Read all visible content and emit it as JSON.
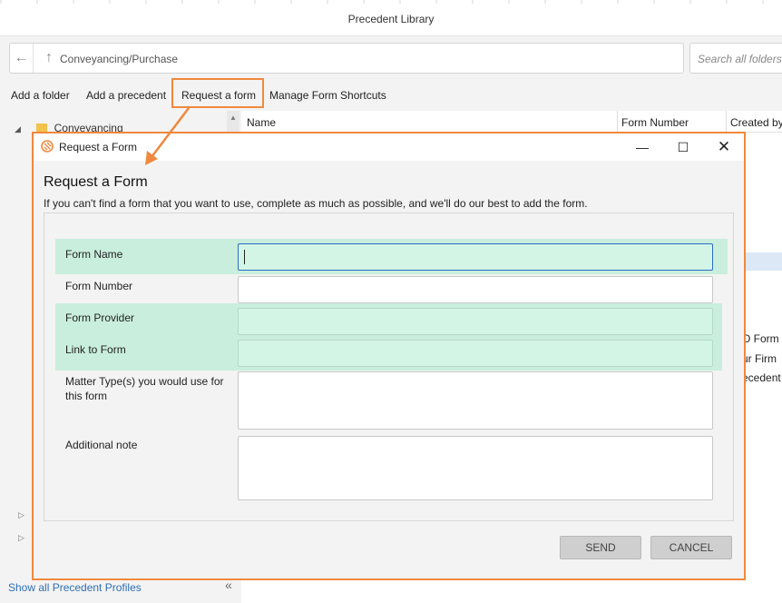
{
  "background_window": {
    "title": "Precedent Library",
    "address": {
      "path": "Conveyancing/Purchase",
      "search_placeholder": "Search all folders"
    },
    "toolbar": {
      "add_folder": "Add a folder",
      "add_precedent": "Add a precedent",
      "request_form": "Request a form",
      "manage_shortcuts": "Manage Form Shortcuts"
    },
    "tree": {
      "folder": "Conveyancing"
    },
    "grid": {
      "columns": [
        "Name",
        "Form Number",
        "Created by"
      ],
      "peek_rows": [
        "O Form",
        "ur Firm",
        "ecedent"
      ]
    },
    "footer": {
      "show_profiles": "Show all Precedent Profiles",
      "collapse": "«"
    }
  },
  "dialog": {
    "title": "Request a Form",
    "heading": "Request a Form",
    "subtitle": "If you can't find a form that you want to use, complete as much as possible, and we'll do our best to add the form.",
    "window_buttons": {
      "minimize": "—",
      "maximize": "☐",
      "close": "✕"
    },
    "fields": {
      "form_name": {
        "label": "Form Name",
        "value": ""
      },
      "form_number": {
        "label": "Form Number",
        "value": ""
      },
      "form_provider": {
        "label": "Form Provider",
        "value": ""
      },
      "link_to_form": {
        "label": "Link to Form",
        "value": ""
      },
      "matter_types": {
        "label": "Matter Type(s) you would use for this form",
        "value": ""
      },
      "additional_note": {
        "label": "Additional note",
        "value": ""
      }
    },
    "buttons": {
      "send": "SEND",
      "cancel": "CANCEL"
    }
  },
  "colors": {
    "annotation": "#f0883e",
    "highlight_row": "#c9eedd",
    "input_green": "#d3f5e6",
    "focus_border": "#2b6cc4",
    "link": "#2f6fb5"
  }
}
